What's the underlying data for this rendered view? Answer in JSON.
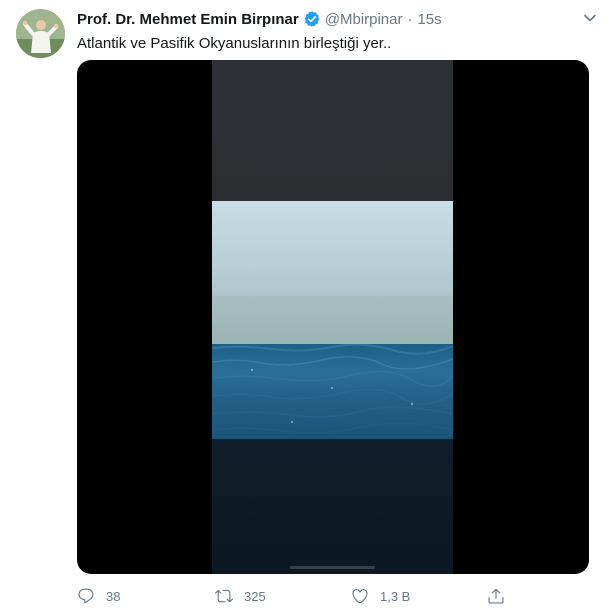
{
  "author": {
    "display_name": "Prof. Dr. Mehmet Emin Birpınar",
    "handle": "@Mbirpinar",
    "verified": true,
    "separator": "·",
    "time": "15s"
  },
  "tweet": {
    "text": "Atlantik ve Pasifik Okyanuslarının birleştiği yer.."
  },
  "media": {
    "type": "video",
    "description_icon": "video-player"
  },
  "actions": {
    "replies": "38",
    "retweets": "325",
    "likes": "1,3 B"
  },
  "colors": {
    "verified": "#1da1f2",
    "text_primary": "#14171a",
    "text_secondary": "#657786"
  },
  "icons": {
    "caret": "chevron-down-icon",
    "reply": "reply-icon",
    "retweet": "retweet-icon",
    "like": "heart-icon",
    "share": "share-icon"
  }
}
